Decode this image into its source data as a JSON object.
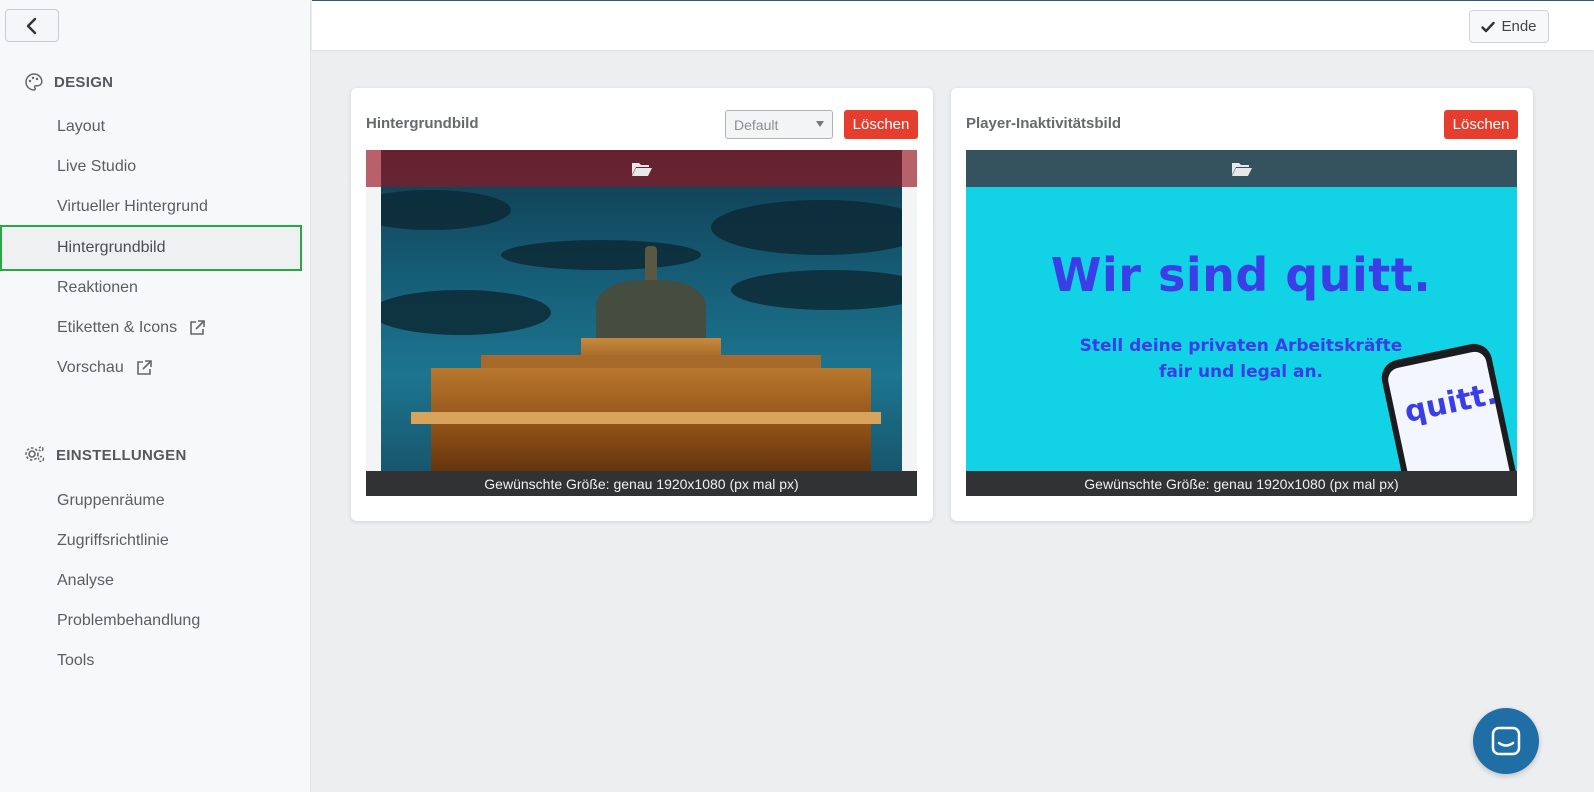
{
  "sidebar": {
    "back_label": "",
    "design": {
      "heading": "DESIGN",
      "items": [
        {
          "label": "Layout"
        },
        {
          "label": "Live Studio"
        },
        {
          "label": "Virtueller Hintergrund"
        },
        {
          "label": "Hintergrundbild"
        },
        {
          "label": "Reaktionen"
        },
        {
          "label": "Etiketten & Icons"
        },
        {
          "label": "Vorschau"
        }
      ]
    },
    "settings": {
      "heading": "EINSTELLUNGEN",
      "items": [
        {
          "label": "Gruppenräume"
        },
        {
          "label": "Zugriffsrichtlinie"
        },
        {
          "label": "Analyse"
        },
        {
          "label": "Problembehandlung"
        },
        {
          "label": "Tools"
        }
      ]
    },
    "active_item": "Hintergrundbild"
  },
  "topbar": {
    "end_label": "Ende"
  },
  "cards": [
    {
      "title": "Hintergrundbild",
      "select_value": "Default",
      "delete_label": "Löschen",
      "caption": "Gewünschte Größe: genau 1920x1080 (px mal px)"
    },
    {
      "title": "Player-Inaktivitätsbild",
      "delete_label": "Löschen",
      "caption": "Gewünschte Größe: genau 1920x1080 (px mal px)",
      "image_headline": "Wir sind quitt.",
      "image_sub_line1": "Stell deine privaten Arbeitskräfte",
      "image_sub_line2": "fair und legal an.",
      "image_logo": "quitt."
    }
  ],
  "colors": {
    "active_border": "#27a844",
    "delete": "#e53e2e",
    "chat": "#1f6fa6"
  }
}
